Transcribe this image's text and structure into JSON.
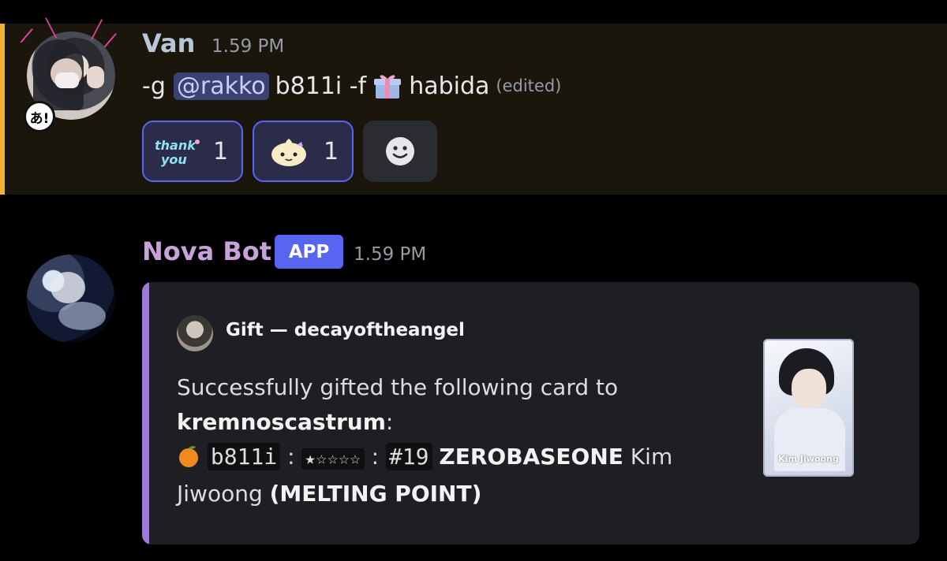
{
  "messages": [
    {
      "author": "Van",
      "time": "1.59 PM",
      "content": {
        "prefix": "-g",
        "mention": "@rakko",
        "middle": "b811i -f",
        "gift_emoji_icon": "gift-box-icon",
        "suffix": "habida",
        "edited": "(edited)"
      },
      "avatar_badge": "あ!",
      "reactions": [
        {
          "emoji": "thank-you-sticker-icon",
          "count": "1"
        },
        {
          "emoji": "cute-creature-emoji-icon",
          "count": "1"
        }
      ],
      "add_reaction_icon": "add-reaction-smiley-icon"
    },
    {
      "author": "Nova Bot",
      "tag": "APP",
      "time": "1.59 PM",
      "embed": {
        "author": "Gift — decayoftheangel",
        "line1": "Successfully gifted the following card to",
        "recipient": "kremnoscastrum",
        "colon": ":",
        "orange_icon": "orange-emoji-icon",
        "code": "b811i",
        "sep1": ":",
        "stars": "★☆☆☆☆",
        "sep2": ":",
        "number": "#19",
        "group": "ZEROBASEONE",
        "member": "Kim Jiwoong",
        "era": "(MELTING POINT)",
        "card_caption": "Kim Jiwoong"
      }
    }
  ],
  "colors": {
    "highlight_bar": "#f0b232",
    "embed_bar": "#9b7bd6",
    "app_tag": "#5865f2",
    "mention_bg": "#3c4270"
  }
}
